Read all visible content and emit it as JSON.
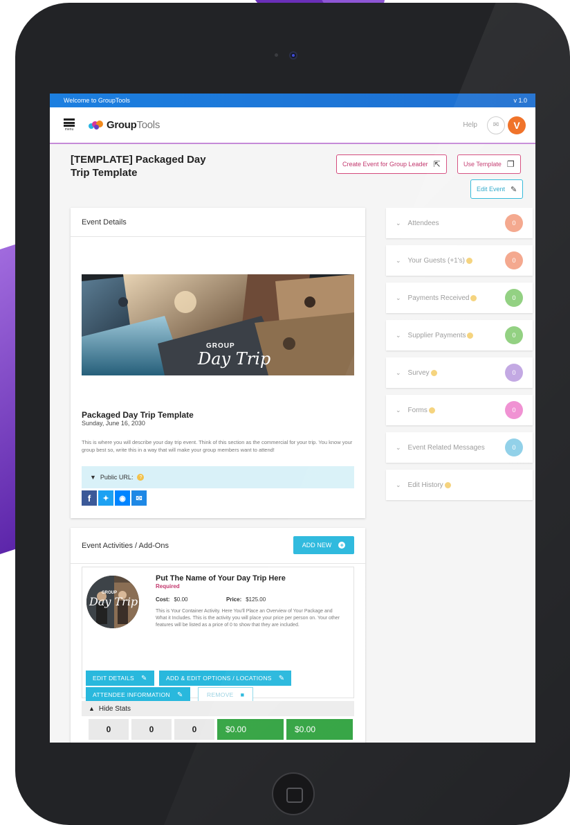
{
  "app": {
    "welcome": "Welcome to GroupTools",
    "version": "v 1.0",
    "menu_label": "menu",
    "logo_bold": "Group",
    "logo_light": "Tools",
    "help": "Help",
    "avatar_initial": "V"
  },
  "page": {
    "title": "[TEMPLATE] Packaged Day Trip Template",
    "create_event_label": "Create Event for Group Leader",
    "use_template_label": "Use Template",
    "edit_event_label": "Edit Event"
  },
  "event_details": {
    "heading": "Event Details",
    "hero_overlay_top": "GROUP",
    "hero_overlay_script": "Day Trip",
    "name": "Packaged Day Trip Template",
    "date": "Sunday, June 16, 2030",
    "description": "This is where you will describe your day trip event. Think of this section as the commercial for your trip. You know your group best so, write this in a way that will make your group members want to attend!",
    "public_url_label": "Public URL:",
    "socials": [
      "facebook-icon",
      "twitter-icon",
      "messenger-icon",
      "email-icon"
    ]
  },
  "sidebar": {
    "items": [
      {
        "label": "Attendees",
        "info": false,
        "count": "0",
        "color": "#f4a58a"
      },
      {
        "label": "Your Guests (+1's)",
        "info": true,
        "count": "0",
        "color": "#f4a58a"
      },
      {
        "label": "Payments Received",
        "info": true,
        "count": "0",
        "color": "#8fcf7e"
      },
      {
        "label": "Supplier Payments",
        "info": true,
        "count": "0",
        "color": "#8fcf7e"
      },
      {
        "label": "Survey",
        "info": true,
        "count": "0",
        "color": "#c1a6e2"
      },
      {
        "label": "Forms",
        "info": true,
        "count": "0",
        "color": "#f08fd2"
      },
      {
        "label": "Event Related Messages",
        "info": false,
        "count": "0",
        "color": "#8fd0e8"
      },
      {
        "label": "Edit History",
        "info": true,
        "count": "",
        "color": ""
      }
    ]
  },
  "activities": {
    "heading": "Event Activities / Add-Ons",
    "add_new_label": "ADD NEW",
    "item": {
      "image_overlay_top": "GROUP",
      "image_overlay_script": "Day Trip",
      "title": "Put The Name of Your Day Trip Here",
      "required": "Required",
      "cost_label": "Cost:",
      "cost_value": "$0.00",
      "price_label": "Price:",
      "price_value": "$125.00",
      "description": "This is Your Container Activity. Here You'll Place an Overview of Your Package and What it Includes. This is the activity you will place your price per person on. Your other features will be listed as a price of 0 to show that they are included.",
      "edit_details_label": "EDIT DETAILS",
      "options_label": "ADD & EDIT OPTIONS / LOCATIONS",
      "attendee_info_label": "ATTENDEE INFORMATION",
      "remove_label": "REMOVE"
    },
    "hide_stats_label": "Hide Stats",
    "stats": [
      "0",
      "0",
      "0",
      "$0.00",
      "$0.00"
    ]
  },
  "colors": {
    "brand_blue": "#1c7fe0",
    "teal": "#29b8dd",
    "pink": "#c2366c",
    "green": "#34a443",
    "avatar": "#ef6c1f"
  }
}
